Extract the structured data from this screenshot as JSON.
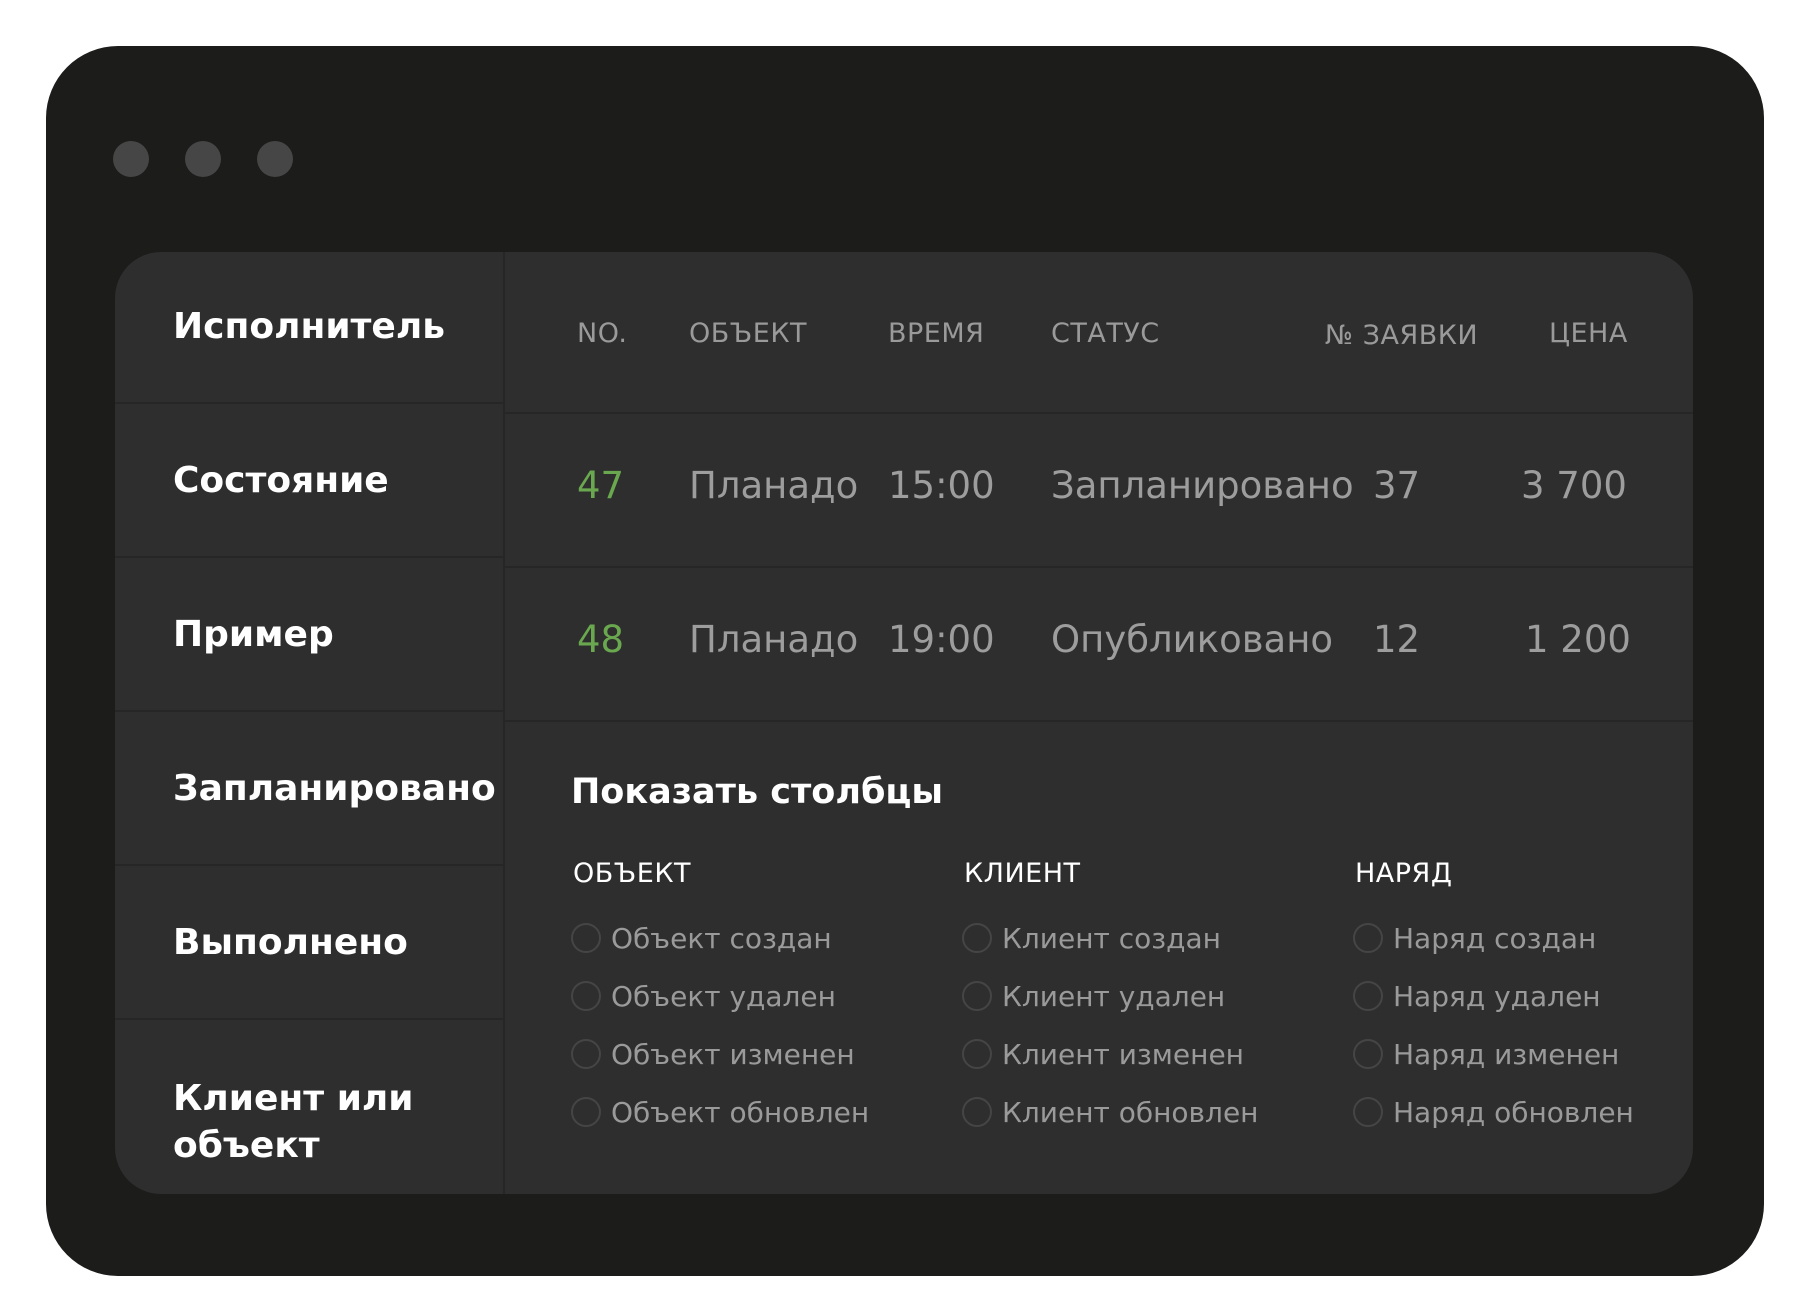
{
  "sidebar": {
    "items": [
      {
        "label": "Исполнитель"
      },
      {
        "label": "Состояние"
      },
      {
        "label": "Пример"
      },
      {
        "label": "Запланировано"
      },
      {
        "label": "Выполнено"
      },
      {
        "label": "Клиент или объект"
      }
    ]
  },
  "table": {
    "headers": [
      "NO.",
      "ОБЪЕКТ",
      "ВРЕМЯ",
      "СТАТУС",
      "№ ЗАЯВКИ",
      "ЦЕНА"
    ],
    "rows": [
      {
        "no": "47",
        "object": "Планадо",
        "time": "15:00",
        "status": "Запланировано",
        "request": "37",
        "price": "3 700"
      },
      {
        "no": "48",
        "object": "Планадо",
        "time": "19:00",
        "status": "Опубликовано",
        "request": "12",
        "price": "1 200"
      }
    ]
  },
  "column_picker": {
    "title": "Показать столбцы",
    "groups": [
      {
        "heading": "ОБЪЕКТ",
        "options": [
          "Объект создан",
          "Объект удален",
          "Объект изменен",
          "Объект обновлен"
        ]
      },
      {
        "heading": "КЛИЕНТ",
        "options": [
          "Клиент создан",
          "Клиент удален",
          "Клиент изменен",
          "Клиент обновлен"
        ]
      },
      {
        "heading": "НАРЯД",
        "options": [
          "Наряд создан",
          "Наряд удален",
          "Наряд изменен",
          "Наряд обновлен"
        ]
      }
    ]
  },
  "colors": {
    "window_bg": "#1c1c1b",
    "panel_bg": "#2e2e2e",
    "accent_green": "#6aa84f"
  }
}
